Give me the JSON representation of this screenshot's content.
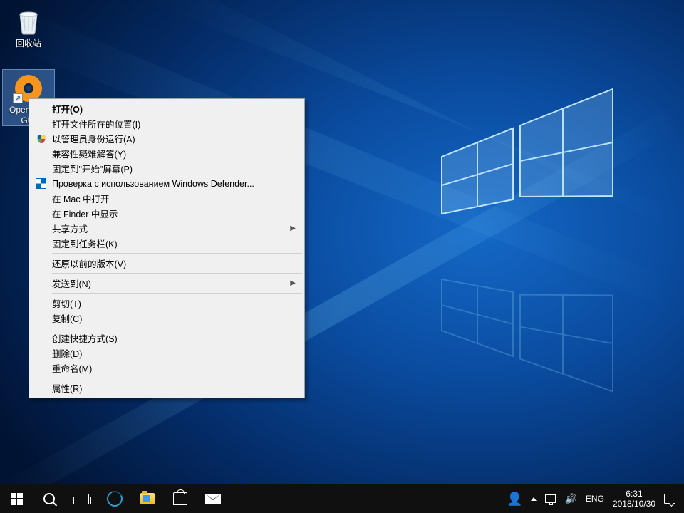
{
  "desktop": {
    "icons": [
      {
        "label": "回收站"
      },
      {
        "label": "OpenVPN GUI"
      }
    ]
  },
  "context_menu": {
    "open": "打开(O)",
    "open_location": "打开文件所在的位置(I)",
    "run_as_admin": "以管理员身份运行(A)",
    "troubleshoot_compat": "兼容性疑难解答(Y)",
    "pin_start": "固定到\"开始\"屏幕(P)",
    "defender_scan": "Проверка с использованием Windows Defender...",
    "open_in_mac": "在 Mac 中打开",
    "reveal_in_finder": "在 Finder 中显示",
    "share_with": "共享方式",
    "pin_taskbar": "固定到任务栏(K)",
    "restore_versions": "还原以前的版本(V)",
    "send_to": "发送到(N)",
    "cut": "剪切(T)",
    "copy": "复制(C)",
    "create_shortcut": "创建快捷方式(S)",
    "delete": "删除(D)",
    "rename": "重命名(M)",
    "properties": "属性(R)"
  },
  "tray": {
    "ime": "ENG",
    "time": "6:31",
    "date": "2018/10/30"
  }
}
